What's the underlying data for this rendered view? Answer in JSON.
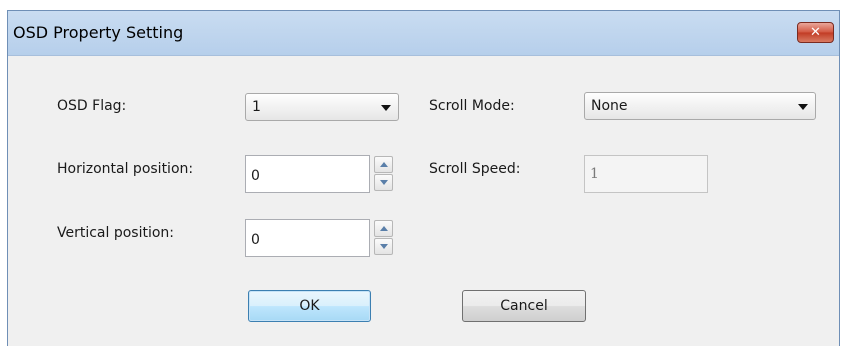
{
  "window": {
    "title": "OSD Property Setting",
    "close_label": "✕"
  },
  "form": {
    "osd_flag": {
      "label": "OSD Flag:",
      "value": "1"
    },
    "horizontal_position": {
      "label": "Horizontal position:",
      "value": "0"
    },
    "vertical_position": {
      "label": "Vertical position:",
      "value": "0"
    },
    "scroll_mode": {
      "label": "Scroll Mode:",
      "value": "None"
    },
    "scroll_speed": {
      "label": "Scroll Speed:",
      "value": "1",
      "disabled": true
    }
  },
  "buttons": {
    "ok_label": "OK",
    "cancel_label": "Cancel"
  },
  "colors": {
    "titlebar": "#c9dcf1",
    "close_button": "#c13b24",
    "ok_button_border": "#3c7fb1"
  }
}
